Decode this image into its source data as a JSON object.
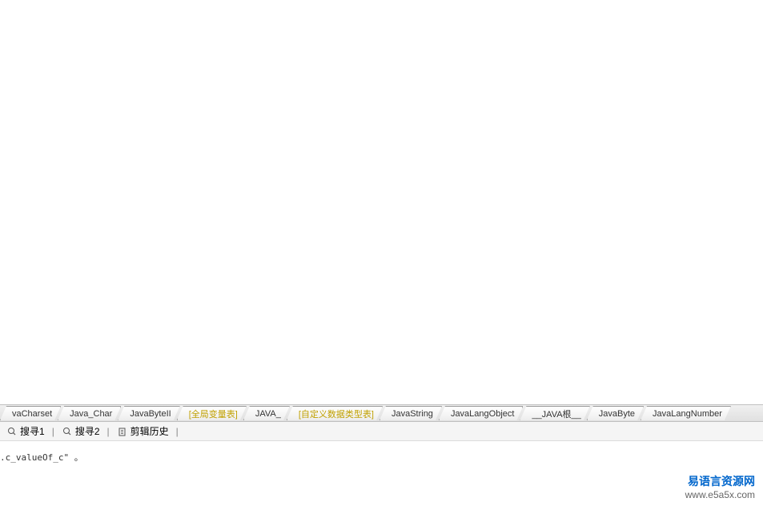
{
  "tabs": [
    {
      "label": "vaCharset",
      "highlighted": false
    },
    {
      "label": "Java_Char",
      "highlighted": false
    },
    {
      "label": "JavaByteII",
      "highlighted": false
    },
    {
      "label": "[全局变量表]",
      "highlighted": true
    },
    {
      "label": "JAVA_",
      "highlighted": false
    },
    {
      "label": "[自定义数据类型表]",
      "highlighted": true
    },
    {
      "label": "JavaString",
      "highlighted": false
    },
    {
      "label": "JavaLangObject",
      "highlighted": false
    },
    {
      "label": "__JAVA根__",
      "highlighted": false
    },
    {
      "label": "JavaByte",
      "highlighted": false
    },
    {
      "label": "JavaLangNumber",
      "highlighted": false
    }
  ],
  "searchBar": {
    "search1": "搜寻1",
    "search2": "搜寻2",
    "clipHistory": "剪辑历史"
  },
  "codeText": ".c_valueOf_c\" 。",
  "watermark": {
    "title": "易语言资源网",
    "url": "www.e5a5x.com"
  }
}
